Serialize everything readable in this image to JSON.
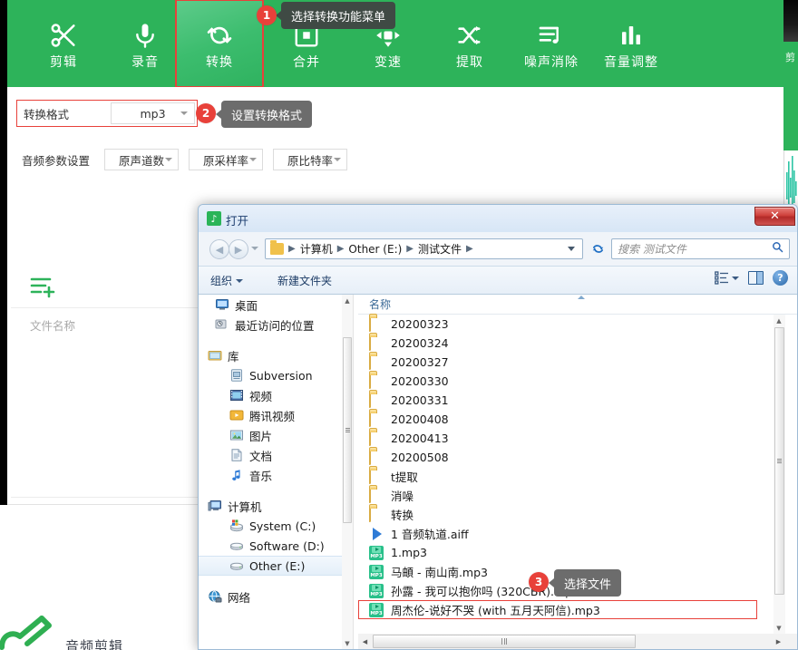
{
  "app": {
    "toolbar": [
      {
        "label": "剪辑",
        "icon": "scissors-icon"
      },
      {
        "label": "录音",
        "icon": "microphone-icon"
      },
      {
        "label": "转换",
        "icon": "convert-refresh-icon"
      },
      {
        "label": "合并",
        "icon": "merge-square-icon"
      },
      {
        "label": "变速",
        "icon": "speed-cross-icon"
      },
      {
        "label": "提取",
        "icon": "shuffle-extract-icon"
      },
      {
        "label": "噪声消除",
        "icon": "noise-note-icon"
      },
      {
        "label": "音量调整",
        "icon": "volume-bars-icon"
      }
    ],
    "active_tool": "转换",
    "format_label": "转换格式",
    "format_value": "mp3",
    "params_label": "音频参数设置",
    "params": [
      "原声道数",
      "原采样率",
      "原比特率"
    ],
    "file_list_header": "文件名称",
    "add_file_icon": "add-file-icon",
    "logo_text": "音频剪辑",
    "right_window_label": "剪"
  },
  "callouts": [
    {
      "num": "1",
      "text": "选择转换功能菜单",
      "style": "dark"
    },
    {
      "num": "2",
      "text": "设置转换格式",
      "style": "grey"
    },
    {
      "num": "3",
      "text": "选择文件",
      "style": "grey"
    }
  ],
  "dialog": {
    "title": "打开",
    "icon": "music-note-icon",
    "close_label": "✕",
    "nav": {
      "back_icon": "back-arrow-icon",
      "forward_icon": "forward-arrow-icon",
      "dropdown_icon": "chevron-down-icon",
      "refresh_icon": "refresh-icon",
      "breadcrumb": [
        "计算机",
        "Other (E:)",
        "测试文件"
      ],
      "search_placeholder": "搜索 测试文件",
      "search_icon": "search-icon"
    },
    "toolbar": {
      "organize": "组织",
      "new_folder": "新建文件夹",
      "view_icon": "view-mode-icon",
      "preview_pane_icon": "preview-pane-icon",
      "help_icon": "help-icon"
    },
    "sidebar": [
      {
        "label": "桌面",
        "icon": "desktop-icon",
        "level": 1
      },
      {
        "label": "最近访问的位置",
        "icon": "recent-places-icon",
        "level": 1
      },
      {
        "label": "",
        "icon": "gap",
        "level": 0
      },
      {
        "label": "库",
        "icon": "library-icon",
        "level": 0
      },
      {
        "label": "Subversion",
        "icon": "subversion-icon",
        "level": 1
      },
      {
        "label": "视频",
        "icon": "video-icon",
        "level": 1
      },
      {
        "label": "腾讯视频",
        "icon": "tencent-video-icon",
        "level": 1
      },
      {
        "label": "图片",
        "icon": "pictures-icon",
        "level": 1
      },
      {
        "label": "文档",
        "icon": "documents-icon",
        "level": 1
      },
      {
        "label": "音乐",
        "icon": "music-icon",
        "level": 1
      },
      {
        "label": "",
        "icon": "gap",
        "level": 0
      },
      {
        "label": "计算机",
        "icon": "computer-icon",
        "level": 0
      },
      {
        "label": "System (C:)",
        "icon": "system-drive-icon",
        "level": 1
      },
      {
        "label": "Software (D:)",
        "icon": "drive-icon",
        "level": 1
      },
      {
        "label": "Other (E:)",
        "icon": "drive-icon",
        "level": 1,
        "selected": true
      },
      {
        "label": "",
        "icon": "gap",
        "level": 0
      },
      {
        "label": "网络",
        "icon": "network-icon",
        "level": 0
      }
    ],
    "column_header": "名称",
    "files": [
      {
        "name": "20200323",
        "type": "folder"
      },
      {
        "name": "20200324",
        "type": "folder"
      },
      {
        "name": "20200327",
        "type": "folder"
      },
      {
        "name": "20200330",
        "type": "folder"
      },
      {
        "name": "20200331",
        "type": "folder"
      },
      {
        "name": "20200408",
        "type": "folder"
      },
      {
        "name": "20200413",
        "type": "folder"
      },
      {
        "name": "20200508",
        "type": "folder"
      },
      {
        "name": "t提取",
        "type": "folder"
      },
      {
        "name": "消噪",
        "type": "folder"
      },
      {
        "name": "转换",
        "type": "folder"
      },
      {
        "name": "1 音频轨道.aiff",
        "type": "aiff"
      },
      {
        "name": "1.mp3",
        "type": "mp3"
      },
      {
        "name": "马頔 - 南山南.mp3",
        "type": "mp3"
      },
      {
        "name": "孙露 - 我可以抱你吗 (320CBR).mp3",
        "type": "mp3"
      },
      {
        "name": "周杰伦-说好不哭 (with 五月天阿信).mp3",
        "type": "mp3",
        "highlighted": true
      }
    ]
  },
  "colors": {
    "brand_green": "#2db35a",
    "accent_red": "#e8413a",
    "dialog_blue": "#9dbbd6",
    "tip_dark": "#3f4a44",
    "tip_grey": "#6c6c6c"
  }
}
